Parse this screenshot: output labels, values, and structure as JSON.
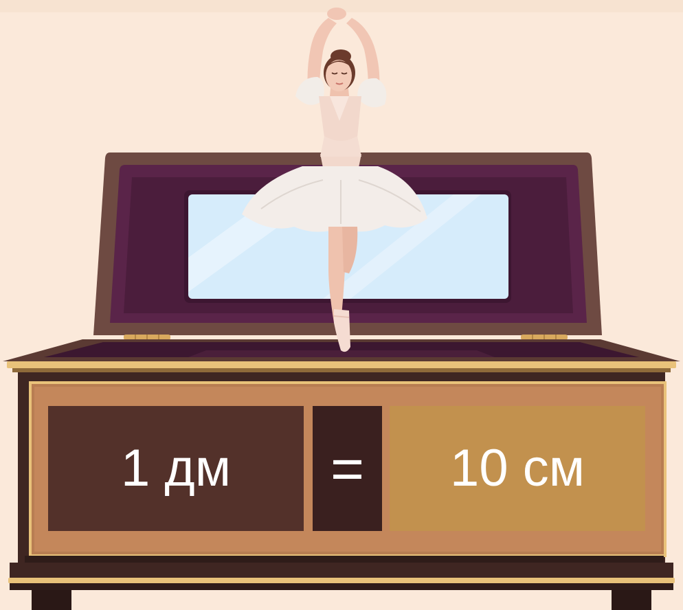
{
  "equation": {
    "left": "1 дм",
    "operator": "=",
    "right": "10 см"
  },
  "colors": {
    "background": "#fbe9da",
    "box_wood": "#3f2622",
    "lid_outer": "#6e4a42",
    "lid_inner": "#4b1d3c",
    "mirror": "#d6ecfb",
    "front_frame": "#c4875b",
    "gold_trim": "#e9c27a",
    "left_panel": "#53312a",
    "mid_panel": "#3a201f",
    "right_panel": "#c2914e",
    "text": "#ffffff"
  },
  "icons": [
    "ballerina-figure",
    "music-box",
    "mirror",
    "hinge-icon"
  ]
}
